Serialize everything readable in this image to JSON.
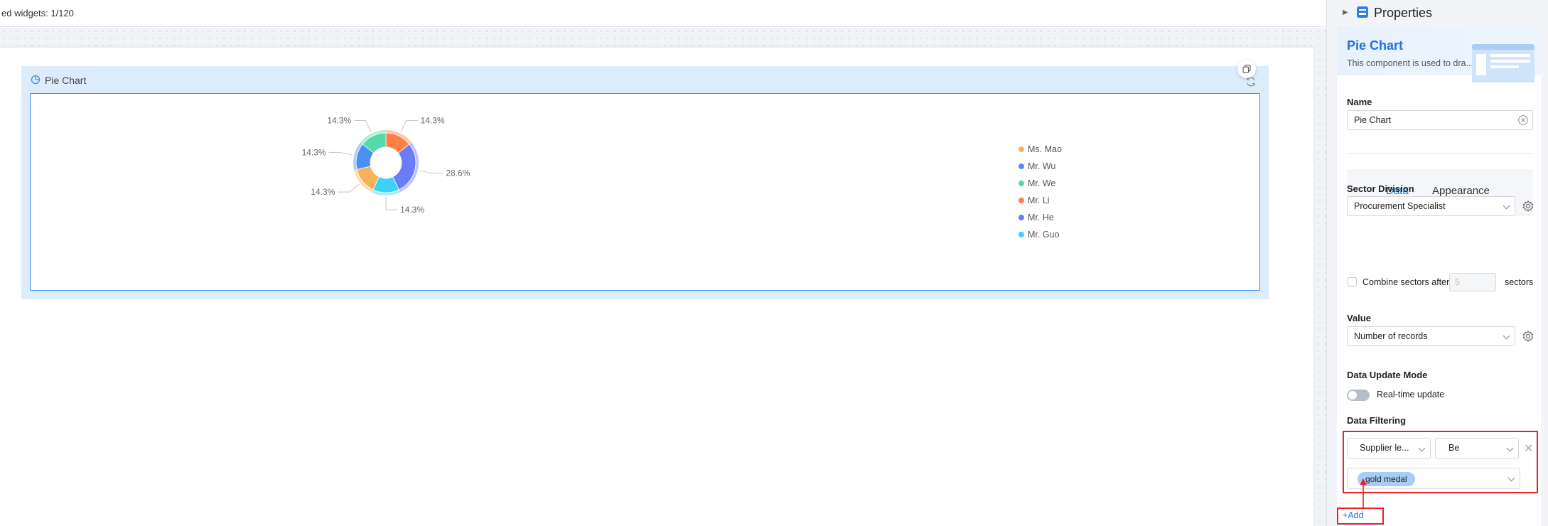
{
  "topbar": {
    "text": "ed widgets: 1/120"
  },
  "widget": {
    "title": "Pie Chart",
    "icons": {
      "title": "pie-chart-icon",
      "copy": "copy-icon",
      "refresh": "refresh-icon"
    }
  },
  "chart_data": {
    "type": "pie",
    "donut": true,
    "categories": [
      "Ms. Mao",
      "Mr. Wu",
      "Mr. We",
      "Mr. Li",
      "Mr. He",
      "Mr. Guo"
    ],
    "values": [
      1,
      1,
      1,
      1,
      2,
      1
    ],
    "order_clockwise_from_top": [
      "Mr. Li",
      "Mr. He",
      "Mr. Guo",
      "Ms. Mao",
      "Mr. Wu",
      "Mr. We"
    ],
    "labels": [
      "14.3%",
      "28.6%",
      "14.3%",
      "14.3%",
      "14.3%",
      "14.3%"
    ],
    "colors": [
      "#fbb05a",
      "#4a90f2",
      "#52dba8",
      "#ff8147",
      "#6a7cf7",
      "#3bd3f5"
    ],
    "legend_position": "right"
  },
  "panel": {
    "title": "Properties",
    "component": {
      "name": "Pie Chart",
      "description": "This component is used to dra..."
    },
    "name_label": "Name",
    "name_value": "Pie Chart",
    "tabs": [
      "Data",
      "Appearance"
    ],
    "sector_division_label": "Sector Division",
    "sector_division_value": "Procurement Specialist",
    "combine_label": "Combine sectors after",
    "combine_placeholder": "5",
    "combine_suffix": "sectors",
    "value_label": "Value",
    "value_value": "Number of records",
    "update_mode_label": "Data Update Mode",
    "realtime_label": "Real-time update",
    "realtime_on": false,
    "filtering_label": "Data Filtering",
    "filter": {
      "field": "Supplier le...",
      "operator": "Be",
      "value_tag": "gold medal"
    },
    "add_label": "Add",
    "accent": "#1f73e0",
    "highlight": "#ee1c25"
  }
}
